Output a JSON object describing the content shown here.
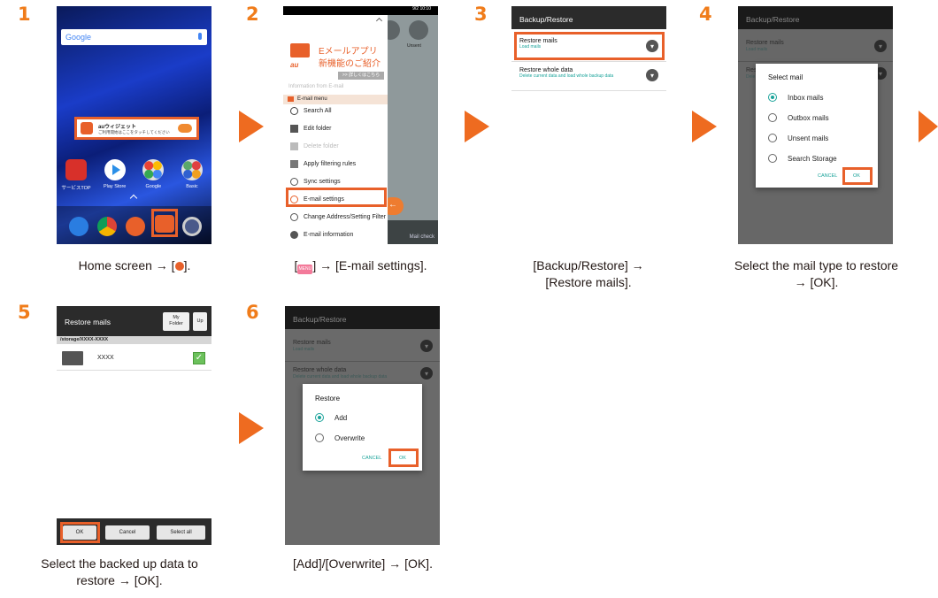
{
  "steps": [
    {
      "number": "1",
      "caption": "Home screen → [",
      "caption_tail": "]."
    },
    {
      "number": "2",
      "caption_pre": "[",
      "caption": "] → [E-mail settings]."
    },
    {
      "number": "3",
      "caption": "[Backup/Restore] →\n[Restore mails]."
    },
    {
      "number": "4",
      "caption": "Select the mail type to restore\n→ [OK]."
    },
    {
      "number": "5",
      "caption": "Select the backed up data to\nrestore → [OK]."
    },
    {
      "number": "6",
      "caption": "[Add]/[Overwrite] → [OK]."
    }
  ],
  "screen1": {
    "search_brand": "Google",
    "widget_title": "auウィジェット",
    "widget_sub": "ご利用開始はここをタッチしてください",
    "apps": [
      "サービスTOP",
      "Play Store",
      "Google",
      "Basic"
    ]
  },
  "screen2": {
    "status": "9/2 10:10",
    "banner_line1": "Eメールアプリ",
    "banner_line2": "新機能のご紹介",
    "banner_link": ">> 詳しくはこちら",
    "au": "au",
    "info_from": "Information from E-mail",
    "menu_header": "E-mail menu",
    "items": [
      "Search All",
      "Edit folder",
      "Delete folder",
      "Apply filtering rules",
      "Sync settings",
      "E-mail settings",
      "Change Address/Setting Filter",
      "E-mail information"
    ],
    "side_label": "Unsent",
    "mail_check": "Mail check",
    "menu_icon_label": "MENU"
  },
  "screen3": {
    "title": "Backup/Restore",
    "item1_title": "Restore mails",
    "item1_sub": "Load mails",
    "item2_title": "Restore whole data",
    "item2_sub": "Delete current data and load whole backup data"
  },
  "screen4": {
    "title": "Backup/Restore",
    "bg_item1": "Restore mails",
    "bg_item1_sub": "Load mails",
    "bg_item2": "Res",
    "bg_item2_sub": "Dele",
    "dialog_title": "Select mail",
    "options": [
      "Inbox mails",
      "Outbox mails",
      "Unsent mails",
      "Search Storage"
    ],
    "cancel": "CANCEL",
    "ok": "OK"
  },
  "screen5": {
    "title": "Restore mails",
    "my_folder": "My Folder",
    "up": "Up",
    "path": "/storage/XXXX-XXXX",
    "folder": "XXXX",
    "ok": "OK",
    "cancel": "Cancel",
    "select_all": "Select all"
  },
  "screen6": {
    "title": "Backup/Restore",
    "bg_item1": "Restore mails",
    "bg_item1_sub": "Load mails",
    "bg_item2": "Restore whole data",
    "bg_item2_sub": "Delete current data and load whole backup data",
    "dialog_title": "Restore",
    "options": [
      "Add",
      "Overwrite"
    ],
    "cancel": "CANCEL",
    "ok": "OK"
  },
  "colors": {
    "accent": "#ee6b20",
    "teal": "#1aa39a"
  }
}
